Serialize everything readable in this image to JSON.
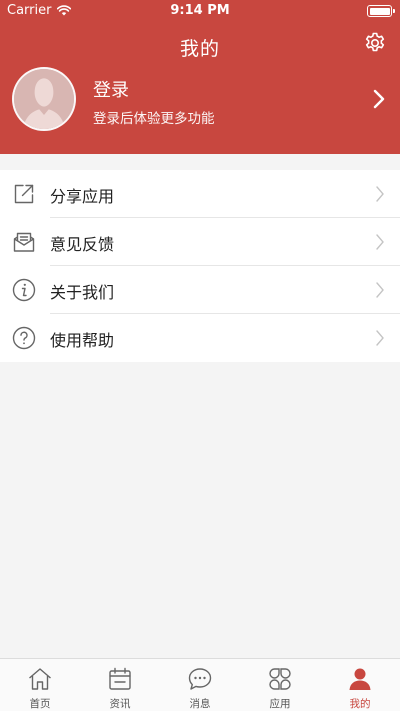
{
  "status_bar": {
    "carrier": "Carrier",
    "time": "9:14 PM"
  },
  "nav": {
    "title": "我的"
  },
  "profile": {
    "title": "登录",
    "subtitle": "登录后体验更多功能"
  },
  "menu": [
    {
      "label": "分享应用",
      "icon": "share-icon"
    },
    {
      "label": "意见反馈",
      "icon": "feedback-envelope-icon"
    },
    {
      "label": "关于我们",
      "icon": "info-icon"
    },
    {
      "label": "使用帮助",
      "icon": "help-icon"
    }
  ],
  "tabs": [
    {
      "label": "首页",
      "icon": "home-icon",
      "active": false
    },
    {
      "label": "资讯",
      "icon": "calendar-icon",
      "active": false
    },
    {
      "label": "消息",
      "icon": "chat-bubble-icon",
      "active": false
    },
    {
      "label": "应用",
      "icon": "apps-grid-icon",
      "active": false
    },
    {
      "label": "我的",
      "icon": "person-icon",
      "active": true
    }
  ],
  "colors": {
    "brand": "#c8473f",
    "tab_inactive": "#555555",
    "divider": "#e6e6e6"
  }
}
